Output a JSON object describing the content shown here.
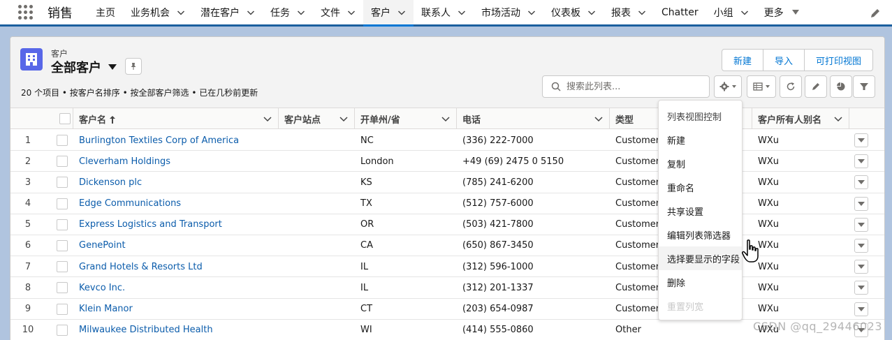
{
  "app": {
    "name": "销售"
  },
  "nav": {
    "items": [
      {
        "label": "主页",
        "chevron": false,
        "active": false
      },
      {
        "label": "业务机会",
        "chevron": true,
        "active": false
      },
      {
        "label": "潜在客户",
        "chevron": true,
        "active": false
      },
      {
        "label": "任务",
        "chevron": true,
        "active": false
      },
      {
        "label": "文件",
        "chevron": true,
        "active": false
      },
      {
        "label": "客户",
        "chevron": true,
        "active": true
      },
      {
        "label": "联系人",
        "chevron": true,
        "active": false
      },
      {
        "label": "市场活动",
        "chevron": true,
        "active": false
      },
      {
        "label": "仪表板",
        "chevron": true,
        "active": false
      },
      {
        "label": "报表",
        "chevron": true,
        "active": false
      },
      {
        "label": "Chatter",
        "chevron": false,
        "active": false
      },
      {
        "label": "小组",
        "chevron": true,
        "active": false
      },
      {
        "label": "更多",
        "chevron": false,
        "active": false
      }
    ]
  },
  "header": {
    "object_label": "客户",
    "view_name": "全部客户",
    "summary": "20 个项目 • 按客户名排序 • 按全部客户筛选 • 已在几秒前更新",
    "buttons": {
      "new": "新建",
      "import": "导入",
      "printable": "可打印视图"
    }
  },
  "search": {
    "placeholder": "搜索此列表..."
  },
  "table": {
    "columns": {
      "name": "客户名",
      "site": "客户站点",
      "state": "开单州/省",
      "phone": "电话",
      "type": "类型",
      "owner": "客户所有人别名"
    },
    "rows": [
      {
        "num": "1",
        "name": "Burlington Textiles Corp of America",
        "state": "NC",
        "phone": "(336) 222-7000",
        "type": "Customer",
        "owner": "WXu"
      },
      {
        "num": "2",
        "name": "Cleverham Holdings",
        "state": "London",
        "phone": "+49 (69) 2475 0 5150",
        "type": "Customer",
        "owner": "WXu"
      },
      {
        "num": "3",
        "name": "Dickenson plc",
        "state": "KS",
        "phone": "(785) 241-6200",
        "type": "Customer",
        "owner": "WXu"
      },
      {
        "num": "4",
        "name": "Edge Communications",
        "state": "TX",
        "phone": "(512) 757-6000",
        "type": "Customer",
        "owner": "WXu"
      },
      {
        "num": "5",
        "name": "Express Logistics and Transport",
        "state": "OR",
        "phone": "(503) 421-7800",
        "type": "Customer",
        "owner": "WXu"
      },
      {
        "num": "6",
        "name": "GenePoint",
        "state": "CA",
        "phone": "(650) 867-3450",
        "type": "Customer",
        "owner": "WXu"
      },
      {
        "num": "7",
        "name": "Grand Hotels & Resorts Ltd",
        "state": "IL",
        "phone": "(312) 596-1000",
        "type": "Customer",
        "owner": "WXu"
      },
      {
        "num": "8",
        "name": "Kevco Inc.",
        "state": "IL",
        "phone": "(312) 201-1337",
        "type": "Customer",
        "owner": "WXu"
      },
      {
        "num": "9",
        "name": "Klein Manor",
        "state": "CT",
        "phone": "(203) 654-0987",
        "type": "Customer",
        "owner": "WXu"
      },
      {
        "num": "10",
        "name": "Milwaukee Distributed Health",
        "state": "WI",
        "phone": "(414) 555-0860",
        "type": "Other",
        "owner": "WXu"
      }
    ]
  },
  "menu": {
    "header": "列表视图控制",
    "items": [
      "新建",
      "复制",
      "重命名",
      "共享设置",
      "编辑列表筛选器",
      "选择要显示的字段",
      "删除"
    ],
    "disabled": "重置列宽"
  },
  "watermark": "CSDN @qq_29446023",
  "colors": {
    "nav_border": "#1b5f9e",
    "link": "#0b5cab",
    "accent": "#0176d3",
    "object_icon": "#5867e8"
  }
}
